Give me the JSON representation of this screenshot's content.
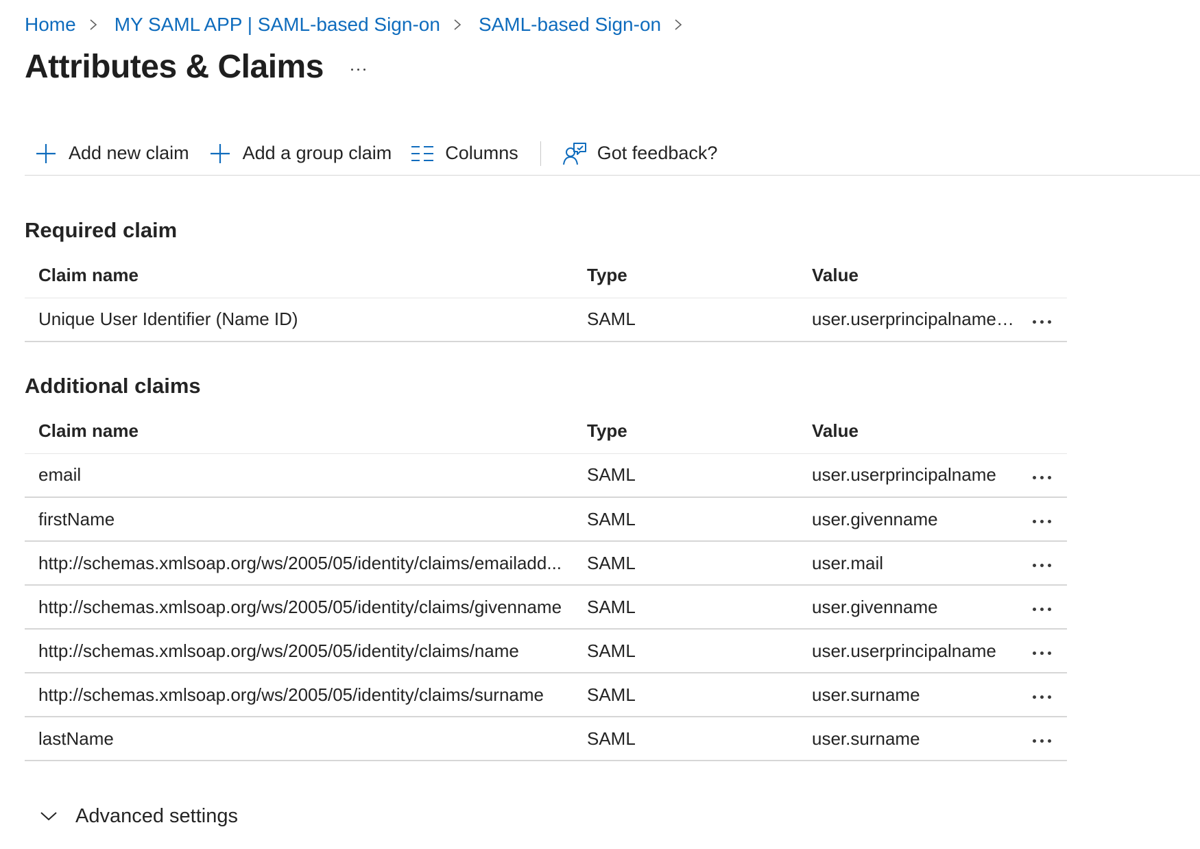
{
  "breadcrumb": {
    "items": [
      "Home",
      "MY SAML APP | SAML-based Sign-on",
      "SAML-based Sign-on"
    ]
  },
  "page": {
    "title": "Attributes & Claims"
  },
  "toolbar": {
    "add_claim": "Add new claim",
    "add_group_claim": "Add a group claim",
    "columns": "Columns",
    "feedback": "Got feedback?"
  },
  "required": {
    "title": "Required claim",
    "headers": {
      "name": "Claim name",
      "type": "Type",
      "value": "Value"
    },
    "rows": [
      {
        "name": "Unique User Identifier (Name ID)",
        "type": "SAML",
        "value": "user.userprincipalname [..."
      }
    ]
  },
  "additional": {
    "title": "Additional claims",
    "headers": {
      "name": "Claim name",
      "type": "Type",
      "value": "Value"
    },
    "rows": [
      {
        "name": "email",
        "type": "SAML",
        "value": "user.userprincipalname"
      },
      {
        "name": "firstName",
        "type": "SAML",
        "value": "user.givenname"
      },
      {
        "name": "http://schemas.xmlsoap.org/ws/2005/05/identity/claims/emailadd...",
        "type": "SAML",
        "value": "user.mail"
      },
      {
        "name": "http://schemas.xmlsoap.org/ws/2005/05/identity/claims/givenname",
        "type": "SAML",
        "value": "user.givenname"
      },
      {
        "name": "http://schemas.xmlsoap.org/ws/2005/05/identity/claims/name",
        "type": "SAML",
        "value": "user.userprincipalname"
      },
      {
        "name": "http://schemas.xmlsoap.org/ws/2005/05/identity/claims/surname",
        "type": "SAML",
        "value": "user.surname"
      },
      {
        "name": "lastName",
        "type": "SAML",
        "value": "user.surname"
      }
    ]
  },
  "advanced": {
    "label": "Advanced settings"
  },
  "colors": {
    "link": "#0f6cbd",
    "text": "#242424",
    "border": "#d6d6d6"
  },
  "icons": {
    "breadcrumb_separator": "chevron-right-icon",
    "title_more": "more-horizontal-icon",
    "add_claim": "plus-icon",
    "add_group_claim": "plus-icon",
    "columns": "columns-list-icon",
    "feedback": "person-feedback-icon",
    "row_more": "more-horizontal-icon",
    "advanced": "chevron-down-icon"
  }
}
